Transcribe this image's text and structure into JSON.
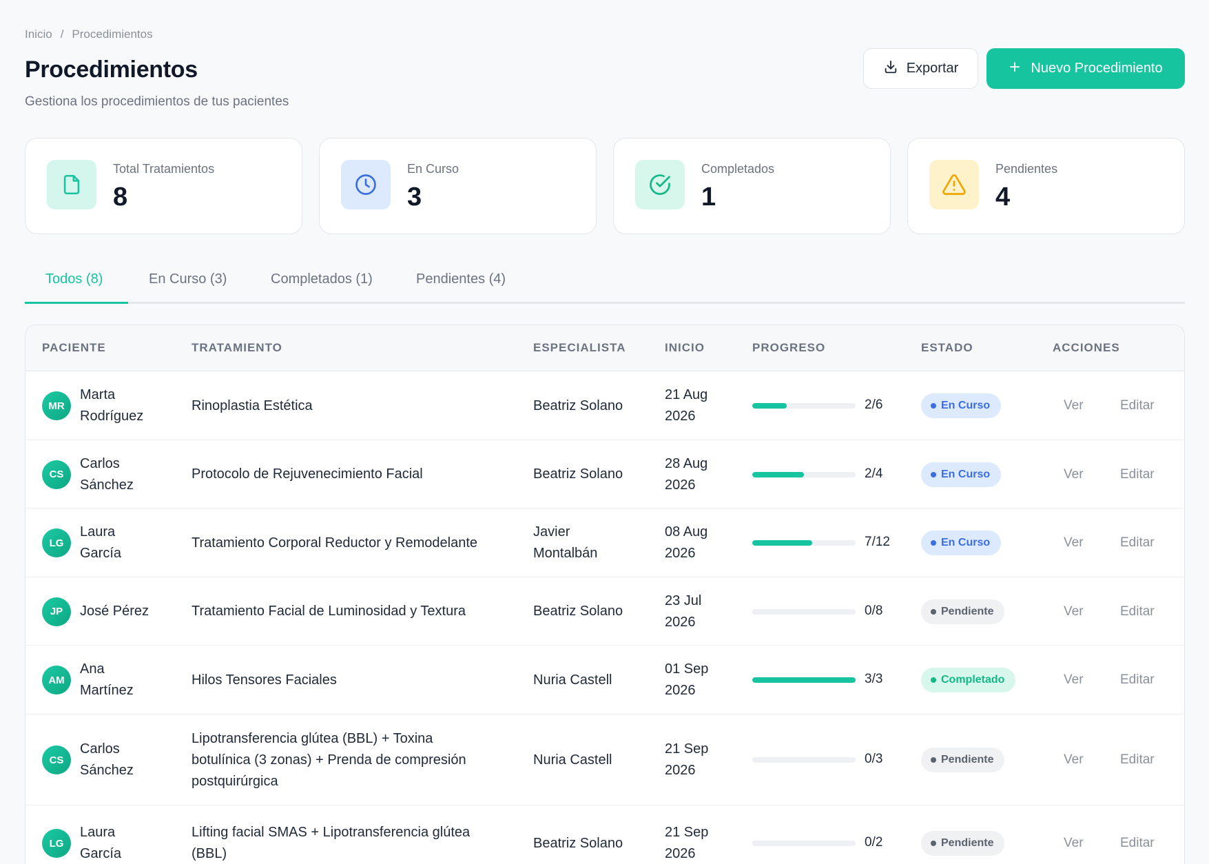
{
  "breadcrumb": {
    "home": "Inicio",
    "separator": "/",
    "current": "Procedimientos"
  },
  "header": {
    "title": "Procedimientos",
    "subtitle": "Gestiona los procedimientos de tus pacientes",
    "export_label": "Exportar",
    "new_label": "Nuevo Procedimiento"
  },
  "colors": {
    "accent": "#16c4a0",
    "en_curso": "#3b6fe0",
    "pendiente": "#5b6270",
    "warning": "#f0a500"
  },
  "stats": [
    {
      "label": "Total Tratamientos",
      "value": "8",
      "icon": "document-icon"
    },
    {
      "label": "En Curso",
      "value": "3",
      "icon": "clock-icon"
    },
    {
      "label": "Completados",
      "value": "1",
      "icon": "check-circle-icon"
    },
    {
      "label": "Pendientes",
      "value": "4",
      "icon": "warning-icon"
    }
  ],
  "tabs": [
    {
      "label": "Todos (8)",
      "active": true
    },
    {
      "label": "En Curso (3)",
      "active": false
    },
    {
      "label": "Completados (1)",
      "active": false
    },
    {
      "label": "Pendientes (4)",
      "active": false
    }
  ],
  "table": {
    "columns": [
      "PACIENTE",
      "TRATAMIENTO",
      "ESPECIALISTA",
      "INICIO",
      "PROGRESO",
      "ESTADO",
      "ACCIONES"
    ],
    "view_label": "Ver",
    "edit_label": "Editar",
    "rows": [
      {
        "initials": "MR",
        "patient": [
          "Marta",
          "Rodríguez"
        ],
        "treatment": [
          "Rinoplastia Estética"
        ],
        "specialist": [
          "Beatriz Solano"
        ],
        "start": [
          "21 Aug",
          "2026"
        ],
        "progress_text": "2/6",
        "progress": 0.333,
        "status": "En Curso",
        "status_key": "encurso"
      },
      {
        "initials": "CS",
        "patient": [
          "Carlos",
          "Sánchez"
        ],
        "treatment": [
          "Protocolo de Rejuvenecimiento Facial"
        ],
        "specialist": [
          "Beatriz Solano"
        ],
        "start": [
          "28 Aug",
          "2026"
        ],
        "progress_text": "2/4",
        "progress": 0.5,
        "status": "En Curso",
        "status_key": "encurso"
      },
      {
        "initials": "LG",
        "patient": [
          "Laura",
          "García"
        ],
        "treatment": [
          "Tratamiento Corporal Reductor y Remodelante"
        ],
        "specialist": [
          "Javier",
          "Montalbán"
        ],
        "start": [
          "08 Aug",
          "2026"
        ],
        "progress_text": "7/12",
        "progress": 0.583,
        "status": "En Curso",
        "status_key": "encurso"
      },
      {
        "initials": "JP",
        "patient": [
          "José Pérez"
        ],
        "treatment": [
          "Tratamiento Facial de Luminosidad y Textura"
        ],
        "specialist": [
          "Beatriz Solano"
        ],
        "start": [
          "23 Jul",
          "2026"
        ],
        "progress_text": "0/8",
        "progress": 0,
        "status": "Pendiente",
        "status_key": "pendiente"
      },
      {
        "initials": "AM",
        "patient": [
          "Ana",
          "Martínez"
        ],
        "treatment": [
          "Hilos Tensores Faciales"
        ],
        "specialist": [
          "Nuria Castell"
        ],
        "start": [
          "01 Sep",
          "2026"
        ],
        "progress_text": "3/3",
        "progress": 1,
        "status": "Completado",
        "status_key": "completado"
      },
      {
        "initials": "CS",
        "patient": [
          "Carlos",
          "Sánchez"
        ],
        "treatment": [
          "Lipotransferencia glútea (BBL) + Toxina",
          "botulínica (3 zonas) + Prenda de compresión",
          "postquirúrgica"
        ],
        "specialist": [
          "Nuria Castell"
        ],
        "start": [
          "21 Sep",
          "2026"
        ],
        "progress_text": "0/3",
        "progress": 0,
        "status": "Pendiente",
        "status_key": "pendiente"
      },
      {
        "initials": "LG",
        "patient": [
          "Laura",
          "García"
        ],
        "treatment": [
          "Lifting facial SMAS + Lipotransferencia glútea",
          "(BBL)"
        ],
        "specialist": [
          "Beatriz Solano"
        ],
        "start": [
          "21 Sep",
          "2026"
        ],
        "progress_text": "0/2",
        "progress": 0,
        "status": "Pendiente",
        "status_key": "pendiente"
      }
    ]
  }
}
